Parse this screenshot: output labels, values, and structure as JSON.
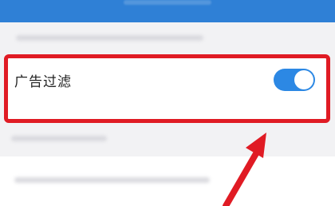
{
  "setting": {
    "label": "广告过滤",
    "enabled": true
  },
  "colors": {
    "header_blue": "#2f80d6",
    "toggle_on": "#2c88e4",
    "highlight_red": "#e01b24"
  }
}
